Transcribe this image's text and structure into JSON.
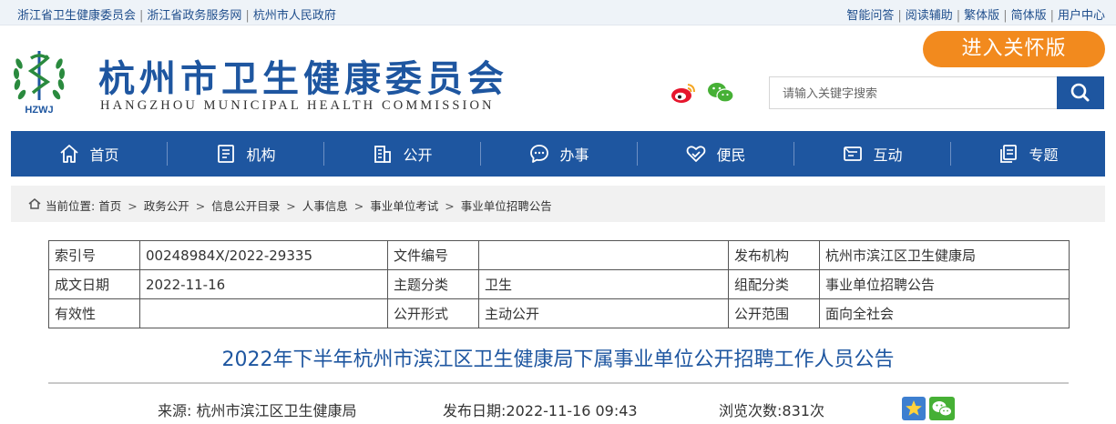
{
  "top_links": {
    "left": [
      "浙江省卫生健康委员会",
      "浙江省政务服务网",
      "杭州市人民政府"
    ],
    "right": [
      "智能问答",
      "阅读辅助",
      "繁体版",
      "简体版",
      "用户中心"
    ]
  },
  "header": {
    "logo_text": "HZWJ",
    "title_cn": "杭州市卫生健康委员会",
    "title_en": "HANGZHOU MUNICIPAL HEALTH COMMISSION",
    "care_mode_label": "进入关怀版",
    "search_placeholder": "请输入关键字搜索"
  },
  "nav": [
    {
      "label": "首页",
      "icon": "home-icon"
    },
    {
      "label": "机构",
      "icon": "document-icon"
    },
    {
      "label": "公开",
      "icon": "building-icon"
    },
    {
      "label": "办事",
      "icon": "chat-icon"
    },
    {
      "label": "便民",
      "icon": "handshake-icon"
    },
    {
      "label": "互动",
      "icon": "message-icon"
    },
    {
      "label": "专题",
      "icon": "files-icon"
    }
  ],
  "breadcrumb": {
    "prefix": "当前位置:",
    "items": [
      "首页",
      "政务公开",
      "信息公开目录",
      "人事信息",
      "事业单位考试",
      "事业单位招聘公告"
    ]
  },
  "info_table": {
    "rows": [
      [
        {
          "label": "索引号",
          "value": "00248984X/2022-29335"
        },
        {
          "label": "文件编号",
          "value": ""
        },
        {
          "label": "发布机构",
          "value": "杭州市滨江区卫生健康局"
        }
      ],
      [
        {
          "label": "成文日期",
          "value": "2022-11-16"
        },
        {
          "label": "主题分类",
          "value": "卫生"
        },
        {
          "label": "组配分类",
          "value": "事业单位招聘公告"
        }
      ],
      [
        {
          "label": "有效性",
          "value": ""
        },
        {
          "label": "公开形式",
          "value": "主动公开"
        },
        {
          "label": "公开范围",
          "value": "面向全社会"
        }
      ]
    ]
  },
  "article": {
    "title": "2022年下半年杭州市滨江区卫生健康局下属事业单位公开招聘工作人员公告",
    "source_label": "来源:",
    "source_value": "杭州市滨江区卫生健康局",
    "date_label": "发布日期:",
    "date_value": "2022-11-16 09:43",
    "views_label": "浏览次数:",
    "views_value": "831次"
  },
  "colors": {
    "brand_blue": "#1e56a0",
    "care_orange": "#f28a1e",
    "logo_green": "#2a8a3e"
  }
}
